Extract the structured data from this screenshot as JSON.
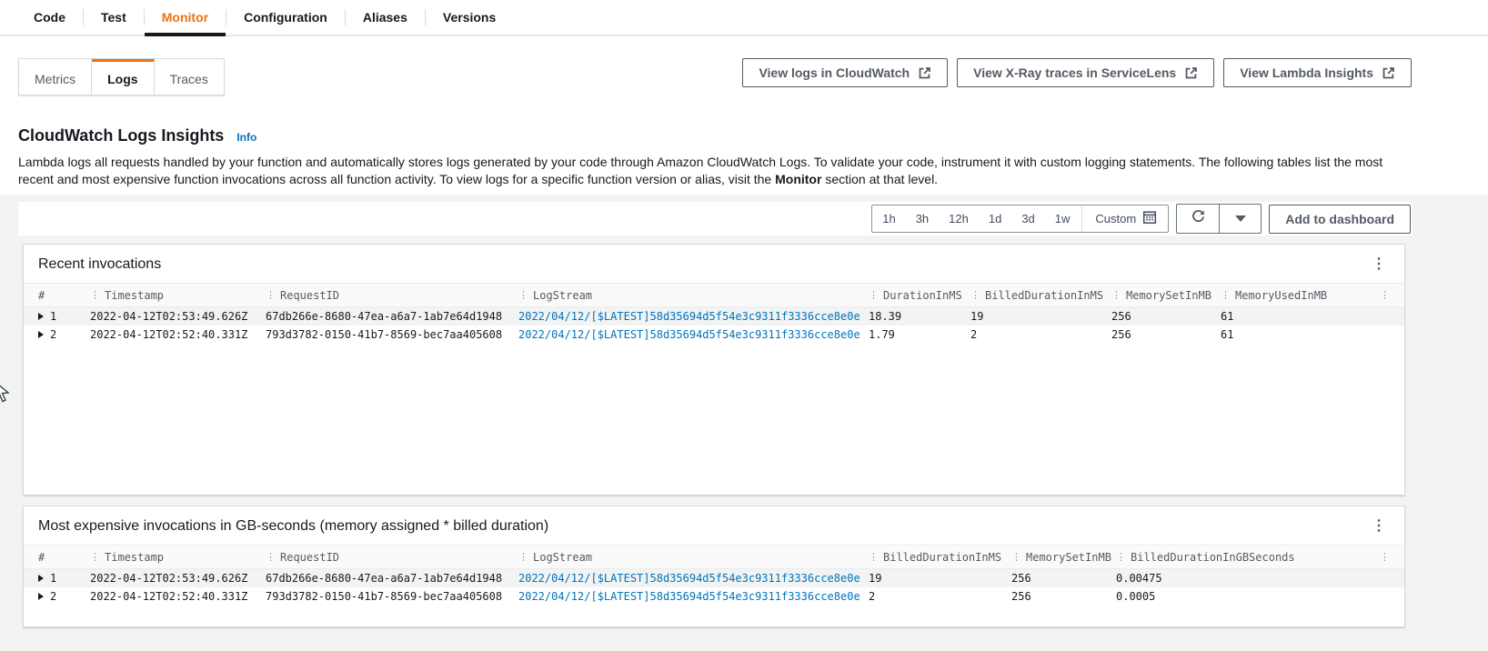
{
  "tabs": {
    "items": [
      "Code",
      "Test",
      "Monitor",
      "Configuration",
      "Aliases",
      "Versions"
    ],
    "active": "Monitor"
  },
  "subtabs": {
    "metrics": "Metrics",
    "logs": "Logs",
    "traces": "Traces",
    "active": "Logs"
  },
  "actions": {
    "cloudwatch": "View logs in CloudWatch",
    "xray": "View X-Ray traces in ServiceLens",
    "insights": "View Lambda Insights"
  },
  "header": {
    "title": "CloudWatch Logs Insights",
    "info": "Info",
    "description_before": "Lambda logs all requests handled by your function and automatically stores logs generated by your code through Amazon CloudWatch Logs. To validate your code, instrument it with custom logging statements. The following tables list the most recent and most expensive function invocations across all function activity. To view logs for a specific function version or alias, visit the ",
    "description_bold": "Monitor",
    "description_after": " section at that level."
  },
  "toolbar": {
    "ranges": [
      "1h",
      "3h",
      "12h",
      "1d",
      "3d",
      "1w"
    ],
    "custom": "Custom",
    "add_to_dashboard": "Add to dashboard"
  },
  "recent": {
    "title": "Recent invocations",
    "columns": [
      "#",
      "Timestamp",
      "RequestID",
      "LogStream",
      "DurationInMS",
      "BilledDurationInMS",
      "MemorySetInMB",
      "MemoryUsedInMB"
    ],
    "rows": [
      {
        "num": "1",
        "timestamp": "2022-04-12T02:53:49.626Z",
        "request_id": "67db266e-8680-47ea-a6a7-1ab7e64d1948",
        "log_stream": "2022/04/12/[$LATEST]58d35694d5f54e3c9311f3336cce8e0e",
        "duration_ms": "18.39",
        "billed_ms": "19",
        "memory_set": "256",
        "memory_used": "61"
      },
      {
        "num": "2",
        "timestamp": "2022-04-12T02:52:40.331Z",
        "request_id": "793d3782-0150-41b7-8569-bec7aa405608",
        "log_stream": "2022/04/12/[$LATEST]58d35694d5f54e3c9311f3336cce8e0e",
        "duration_ms": "1.79",
        "billed_ms": "2",
        "memory_set": "256",
        "memory_used": "61"
      }
    ]
  },
  "expensive": {
    "title": "Most expensive invocations in GB-seconds (memory assigned * billed duration)",
    "columns": [
      "#",
      "Timestamp",
      "RequestID",
      "LogStream",
      "BilledDurationInMS",
      "MemorySetInMB",
      "BilledDurationInGBSeconds"
    ],
    "rows": [
      {
        "num": "1",
        "timestamp": "2022-04-12T02:53:49.626Z",
        "request_id": "67db266e-8680-47ea-a6a7-1ab7e64d1948",
        "log_stream": "2022/04/12/[$LATEST]58d35694d5f54e3c9311f3336cce8e0e",
        "billed_ms": "19",
        "memory_set": "256",
        "gb_seconds": "0.00475"
      },
      {
        "num": "2",
        "timestamp": "2022-04-12T02:52:40.331Z",
        "request_id": "793d3782-0150-41b7-8569-bec7aa405608",
        "log_stream": "2022/04/12/[$LATEST]58d35694d5f54e3c9311f3336cce8e0e",
        "billed_ms": "2",
        "memory_set": "256",
        "gb_seconds": "0.0005"
      }
    ]
  },
  "colors": {
    "accent_orange": "#ec7211",
    "link_blue": "#0073bb",
    "active_underline": "#16191f"
  }
}
